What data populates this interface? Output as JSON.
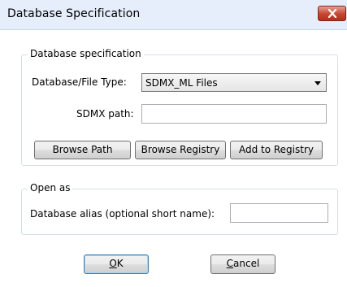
{
  "window": {
    "title": "Database Specification"
  },
  "db_group": {
    "legend": "Database specification",
    "file_type_label": "Database/File Type:",
    "file_type_value": "SDMX_ML Files",
    "sdmx_path_label": "SDMX path:",
    "sdmx_path_value": "",
    "browse_path_label": "Browse Path",
    "browse_registry_label": "Browse Registry",
    "add_registry_label": "Add to Registry"
  },
  "open_group": {
    "legend": "Open as",
    "alias_label": "Database alias (optional short name):",
    "alias_value": ""
  },
  "footer": {
    "ok_first": "O",
    "ok_rest": "K",
    "cancel_first": "C",
    "cancel_rest": "ancel"
  },
  "colors": {
    "titlebar_bg": "#e6eefc",
    "close_button": "#c6452e",
    "default_button_border": "#3c7fb1"
  },
  "icons": {
    "close": "close-icon",
    "dropdown": "chevron-down-icon"
  }
}
